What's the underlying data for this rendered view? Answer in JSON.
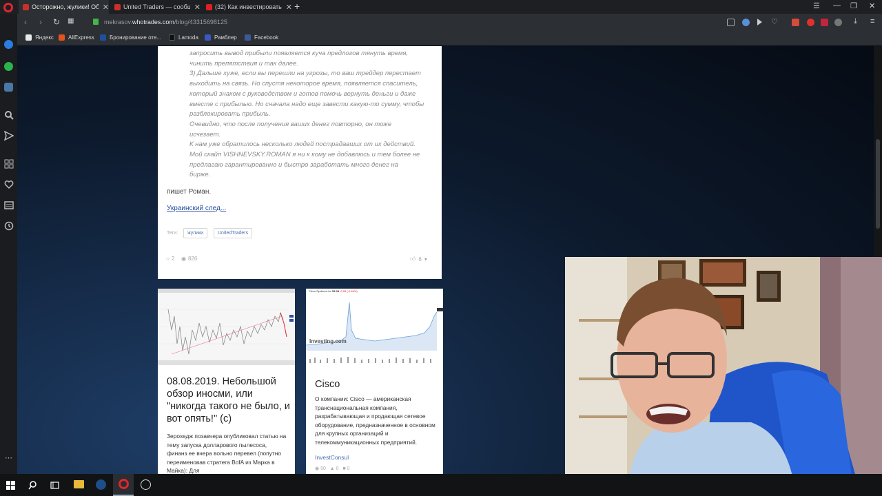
{
  "tabs": [
    {
      "title": "Осторожно, жулики! Об",
      "active": true,
      "color": "#c9302c"
    },
    {
      "title": "United Traders — сообщ",
      "active": false,
      "color": "#c9302c"
    },
    {
      "title": "(32) Как инвестировать в",
      "active": false,
      "color": "#e02020"
    }
  ],
  "address": {
    "prefix": "mekrasov.",
    "domain": "whotrades.com",
    "path": "/blog/43315698125"
  },
  "bookmarks": [
    {
      "label": "Яндекс",
      "color": "#e8e8e8"
    },
    {
      "label": "AliExpress",
      "color": "#e5531a"
    },
    {
      "label": "Бронирование оте...",
      "color": "#1f4f9e"
    },
    {
      "label": "Lamoda",
      "color": "#111111"
    },
    {
      "label": "Рамблер",
      "color": "#3a57c4"
    },
    {
      "label": "Facebook",
      "color": "#3b5998"
    }
  ],
  "post": {
    "quote": [
      "запросить вывод прибыли появляется куча предлогов тянуть время,",
      "чинить препятствия и так далее.",
      "3) Дальше хуже, если вы перешли на угрозы, то ваш трейдер перестает",
      "выходить на связь. Но спустя некоторое время, появляется спаситель,",
      "который знаком с руководством и готов помочь вернуть деньги и даже",
      "вместе с прибылью. Но сначала надо еще завести какую-то сумму, чтобы",
      "разблокировать прибыль.",
      "Очевидно, что после получения ваших денег повторно, он тоже",
      "исчезает.",
      "К нам уже обратилось несколько людей пострадавших от их действий.",
      "Мой скайп VISHNEVSKY.ROMAN я ни к кому не добавлюсь и тем более не",
      "предлагаю гарантированно и быстро заработать много денег на",
      "бирже."
    ],
    "says": "пишет Роман.",
    "link": "Украинский след...",
    "tags_label": "Теги:",
    "tags": [
      "жулики",
      "UnitedTraders"
    ],
    "comments": "2",
    "views": "826",
    "likes": "6"
  },
  "cards": [
    {
      "title": "08.08.2019. Небольшой обзор иносми, или \"никогда такого не было, и вот опять!\" (с)",
      "text": "Зерохедж позавчера опубликовал статью на тему запуска долларового пылесоса, финанз ее вчера вольно перевел (попутно переименовав стратега BofA из Марка в Майка): Для"
    },
    {
      "title": "Cisco",
      "chart_header": "Cisco Systems Inc",
      "chart_price": "53.34",
      "chart_change": "-0.26 (-0.48%)",
      "watermark": "Investing.com",
      "text": "О компании: Cisco — американская транснациональная компания, разрабатывающая и продающая сетевое оборудование, предназначенное в основном для крупных организаций и телекоммуникационных предприятий.",
      "author": "InvestConsul",
      "views": "50",
      "likes": "0",
      "comments": "0"
    }
  ]
}
